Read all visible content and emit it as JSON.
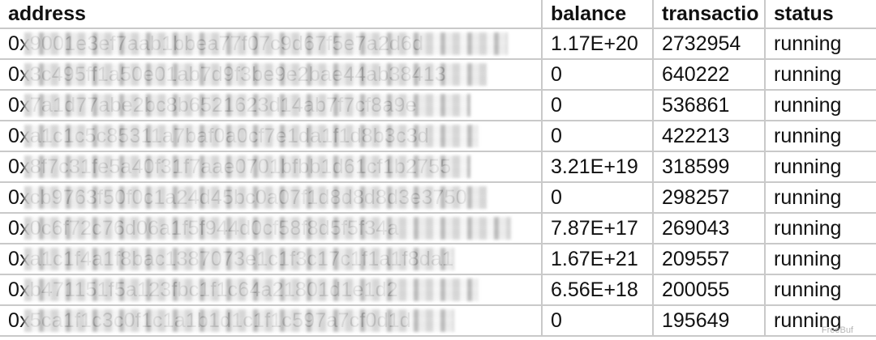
{
  "headers": {
    "address": "address",
    "balance": "balance",
    "transactions": "transactio",
    "status": "status"
  },
  "rows": [
    {
      "address": "0x9001e3ef7aab1bbea77f07c9d67f5e7a2d6d",
      "balance": "1.17E+20",
      "transactions": "2732954",
      "status": "running"
    },
    {
      "address": "0x3c495ff1a50e01ab7d9f3be9e2bae44ab38413",
      "balance": "0",
      "transactions": "640222",
      "status": "running"
    },
    {
      "address": "0x7a1d77abe2bc8b6521623d14ab7f7cf8a9e",
      "balance": "0",
      "transactions": "536861",
      "status": "running"
    },
    {
      "address": "0xa1c1c5c85311a7baf0a0cf7e1da1f1d8b3c3d",
      "balance": "0",
      "transactions": "422213",
      "status": "running"
    },
    {
      "address": "0x8f7c31fe5a40f31f7aae0701bfbb1d61cf1b2755",
      "balance": "3.21E+19",
      "transactions": "318599",
      "status": "running"
    },
    {
      "address": "0xcb9763f50f0c1a24d45bc0a07f1d8d8d8d3e3750",
      "balance": "0",
      "transactions": "298257",
      "status": "running"
    },
    {
      "address": "0x0c6f72c76d06a1f5f944d0cf58f8d5f5f34a",
      "balance": "7.87E+17",
      "transactions": "269043",
      "status": "running"
    },
    {
      "address": "0xa1c1f4a1f8bac1387073e1c1f3c17c1f1a1f8da1",
      "balance": "1.67E+21",
      "transactions": "209557",
      "status": "running"
    },
    {
      "address": "0xb471151f5a123fbc1f1c64a21801d1e1d2",
      "balance": "6.56E+18",
      "transactions": "200055",
      "status": "running"
    },
    {
      "address": "0x5ca1f1c3c0f1c1a1b1d1c1f1c597a7cf0d1d",
      "balance": "0",
      "transactions": "195649",
      "status": "running"
    }
  ],
  "masks": [
    {
      "start": 30,
      "end": 626
    },
    {
      "start": 30,
      "end": 600
    },
    {
      "start": 30,
      "end": 580
    },
    {
      "start": 30,
      "end": 590
    },
    {
      "start": 30,
      "end": 580
    },
    {
      "start": 30,
      "end": 600
    },
    {
      "start": 30,
      "end": 630
    },
    {
      "start": 30,
      "end": 560
    },
    {
      "start": 30,
      "end": 590
    },
    {
      "start": 30,
      "end": 560
    }
  ],
  "watermark": "FreeBuf"
}
